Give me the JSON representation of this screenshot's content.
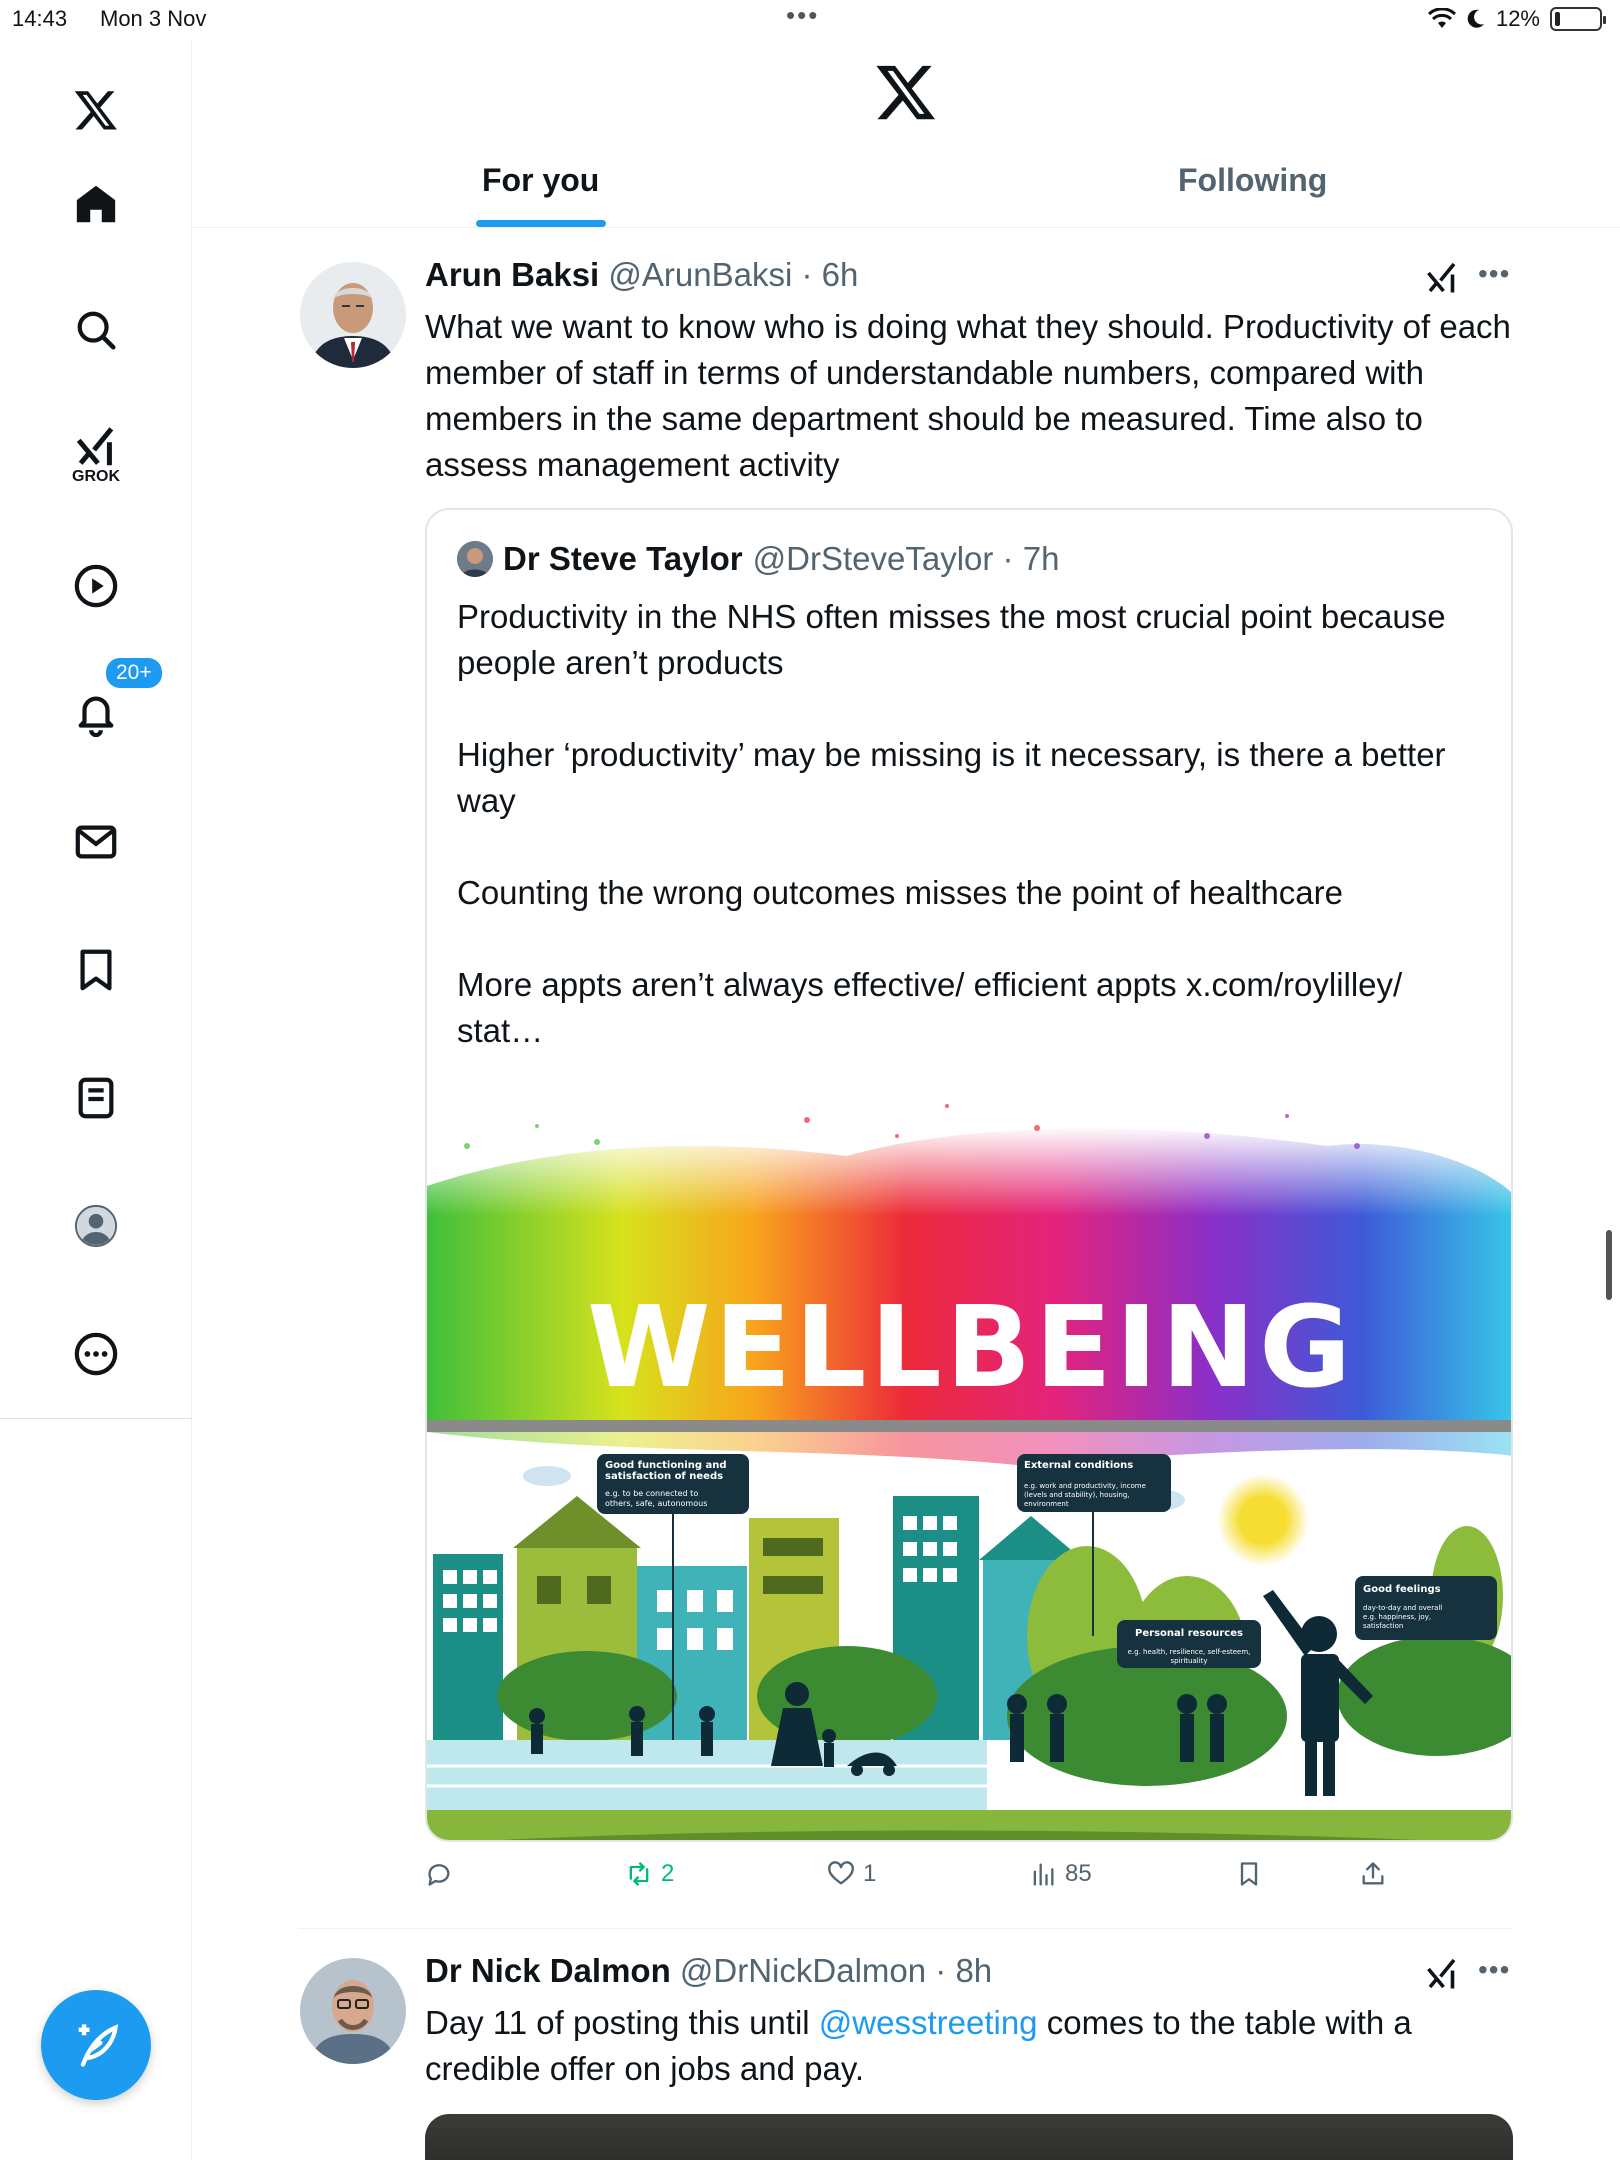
{
  "status": {
    "time": "14:43",
    "date": "Mon 3 Nov",
    "battery": "12%",
    "battery_level": 0.12
  },
  "sidebar": {
    "items": [
      {
        "name": "home",
        "icon": "home-icon"
      },
      {
        "name": "explore",
        "icon": "search-icon"
      },
      {
        "name": "grok",
        "icon": "grok-icon",
        "label": "GROK"
      },
      {
        "name": "videos",
        "icon": "play-icon"
      },
      {
        "name": "notifications",
        "icon": "bell-icon",
        "badge": "20+"
      },
      {
        "name": "messages",
        "icon": "mail-icon"
      },
      {
        "name": "bookmarks",
        "icon": "bookmark-icon"
      },
      {
        "name": "lists",
        "icon": "list-icon"
      },
      {
        "name": "profile",
        "icon": "avatar-icon"
      },
      {
        "name": "more",
        "icon": "more-icon"
      }
    ]
  },
  "tabs": {
    "for_you": "For you",
    "following": "Following"
  },
  "tweets": [
    {
      "name": "Arun Baksi",
      "handle": "@ArunBaksi",
      "time": "6h",
      "text": "What we want to know who is doing what they should. Productivity of each member of staff in terms of understandable numbers, compared with members in the same department should be measured. Time also to assess management activity",
      "quote": {
        "name": "Dr Steve Taylor",
        "handle": "@DrSteveTaylor",
        "time": "7h",
        "paragraphs": [
          "Productivity in the NHS often misses the most crucial point because people aren’t products",
          "Higher ‘productivity’ may be missing is it necessary, is there a better way",
          "Counting the wrong outcomes misses the point of healthcare",
          "More appts aren’t always effective/ efficient appts x.com/roylilley/ stat…"
        ],
        "image": {
          "title": "WELLBEING",
          "labels": {
            "good_functioning_title": "Good functioning and satisfaction of needs",
            "good_functioning_sub": "e.g. to be connected to others, safe, autonomous",
            "external_title": "External conditions",
            "external_sub": "e.g. work and productivity, income (levels and stability), housing, environment",
            "personal_title": "Personal resources",
            "personal_sub": "e.g. health, resilience, self-esteem, spirituality",
            "feelings_title": "Good feelings",
            "feelings_sub": "day-to-day and overall e.g. happiness, joy, satisfaction"
          }
        }
      },
      "actions": {
        "replies": "",
        "reposts": "2",
        "likes": "1",
        "views": "85"
      }
    },
    {
      "name": "Dr Nick Dalmon",
      "handle": "@DrNickDalmon",
      "time": "8h",
      "text_before": "Day 11 of posting this until ",
      "mention": "@wesstreeting",
      "text_after": " comes to the table with a credible offer on jobs and pay."
    }
  ],
  "colors": {
    "accent": "#1d9bf0",
    "repost_active": "#00ba7c",
    "secondary_text": "#536471"
  }
}
